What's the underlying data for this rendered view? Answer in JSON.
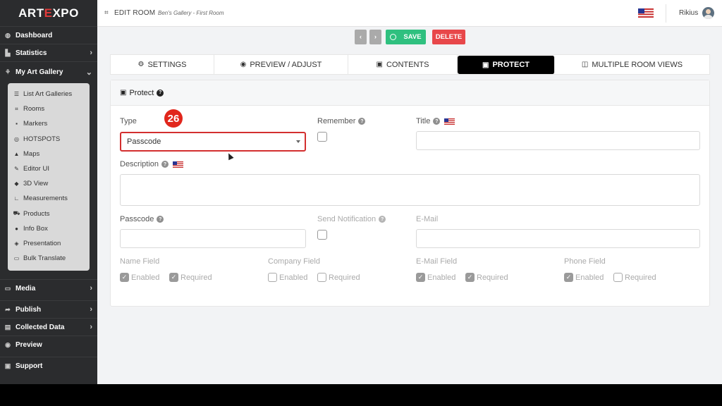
{
  "logo": {
    "pre": "ART",
    "accent": "E",
    "post": "XPO",
    "accent_color": "#e23b3b"
  },
  "sidebar": {
    "items": [
      {
        "label": "Dashboard",
        "icon": "dashboard-icon"
      },
      {
        "label": "Statistics",
        "icon": "chart-icon",
        "has_chevron": true
      },
      {
        "label": "My Art Gallery",
        "icon": "gallery-icon",
        "expanded": true
      },
      {
        "label": "Media",
        "icon": "monitor-icon",
        "has_chevron": true
      },
      {
        "label": "Publish",
        "icon": "share-icon",
        "has_chevron": true
      },
      {
        "label": "Collected Data",
        "icon": "database-icon",
        "has_chevron": true
      },
      {
        "label": "Preview",
        "icon": "eye-icon"
      },
      {
        "label": "Support",
        "icon": "support-icon"
      }
    ],
    "submenu": [
      {
        "label": "List Art Galleries",
        "icon": "list-icon"
      },
      {
        "label": "Rooms",
        "icon": "room-icon"
      },
      {
        "label": "Markers",
        "icon": "marker-icon"
      },
      {
        "label": "HOTSPOTS",
        "icon": "hotspot-icon"
      },
      {
        "label": "Maps",
        "icon": "map-icon"
      },
      {
        "label": "Editor UI",
        "icon": "editor-icon"
      },
      {
        "label": "3D View",
        "icon": "cube-icon"
      },
      {
        "label": "Measurements",
        "icon": "ruler-icon"
      },
      {
        "label": "Products",
        "icon": "cart-icon"
      },
      {
        "label": "Info Box",
        "icon": "info-icon"
      },
      {
        "label": "Presentation",
        "icon": "presentation-icon"
      },
      {
        "label": "Bulk Translate",
        "icon": "translate-icon"
      }
    ]
  },
  "topbar": {
    "title": "EDIT ROOM",
    "breadcrumb": "Ben's Gallery - First Room",
    "user": "Rikius"
  },
  "actions": {
    "prev": "‹",
    "next": "›",
    "save": "SAVE",
    "delete": "DELETE"
  },
  "tabs": [
    {
      "label": "SETTINGS",
      "icon": "gears-icon",
      "glyph": "⚙"
    },
    {
      "label": "PREVIEW / ADJUST",
      "icon": "eye-icon",
      "glyph": "◉"
    },
    {
      "label": "CONTENTS",
      "icon": "images-icon",
      "glyph": "▣"
    },
    {
      "label": "PROTECT",
      "icon": "lock-icon",
      "glyph": "🔒",
      "active": true
    },
    {
      "label": "MULTIPLE ROOM VIEWS",
      "icon": "columns-icon",
      "glyph": "◫"
    }
  ],
  "panel": {
    "title": "Protect",
    "type_label": "Type",
    "type_value": "Passcode",
    "remember_label": "Remember",
    "title_label": "Title",
    "description_label": "Description",
    "passcode_label": "Passcode",
    "send_notification_label": "Send Notification",
    "email_label": "E-Mail",
    "fields": [
      {
        "label": "Name Field",
        "enabled": true,
        "required": true
      },
      {
        "label": "Company Field",
        "enabled": false,
        "required": false
      },
      {
        "label": "E-Mail Field",
        "enabled": true,
        "required": true
      },
      {
        "label": "Phone Field",
        "enabled": true,
        "required": false
      }
    ],
    "enabled_text": "Enabled",
    "required_text": "Required"
  },
  "annotation": {
    "step": "26",
    "color": "#e1261c"
  }
}
